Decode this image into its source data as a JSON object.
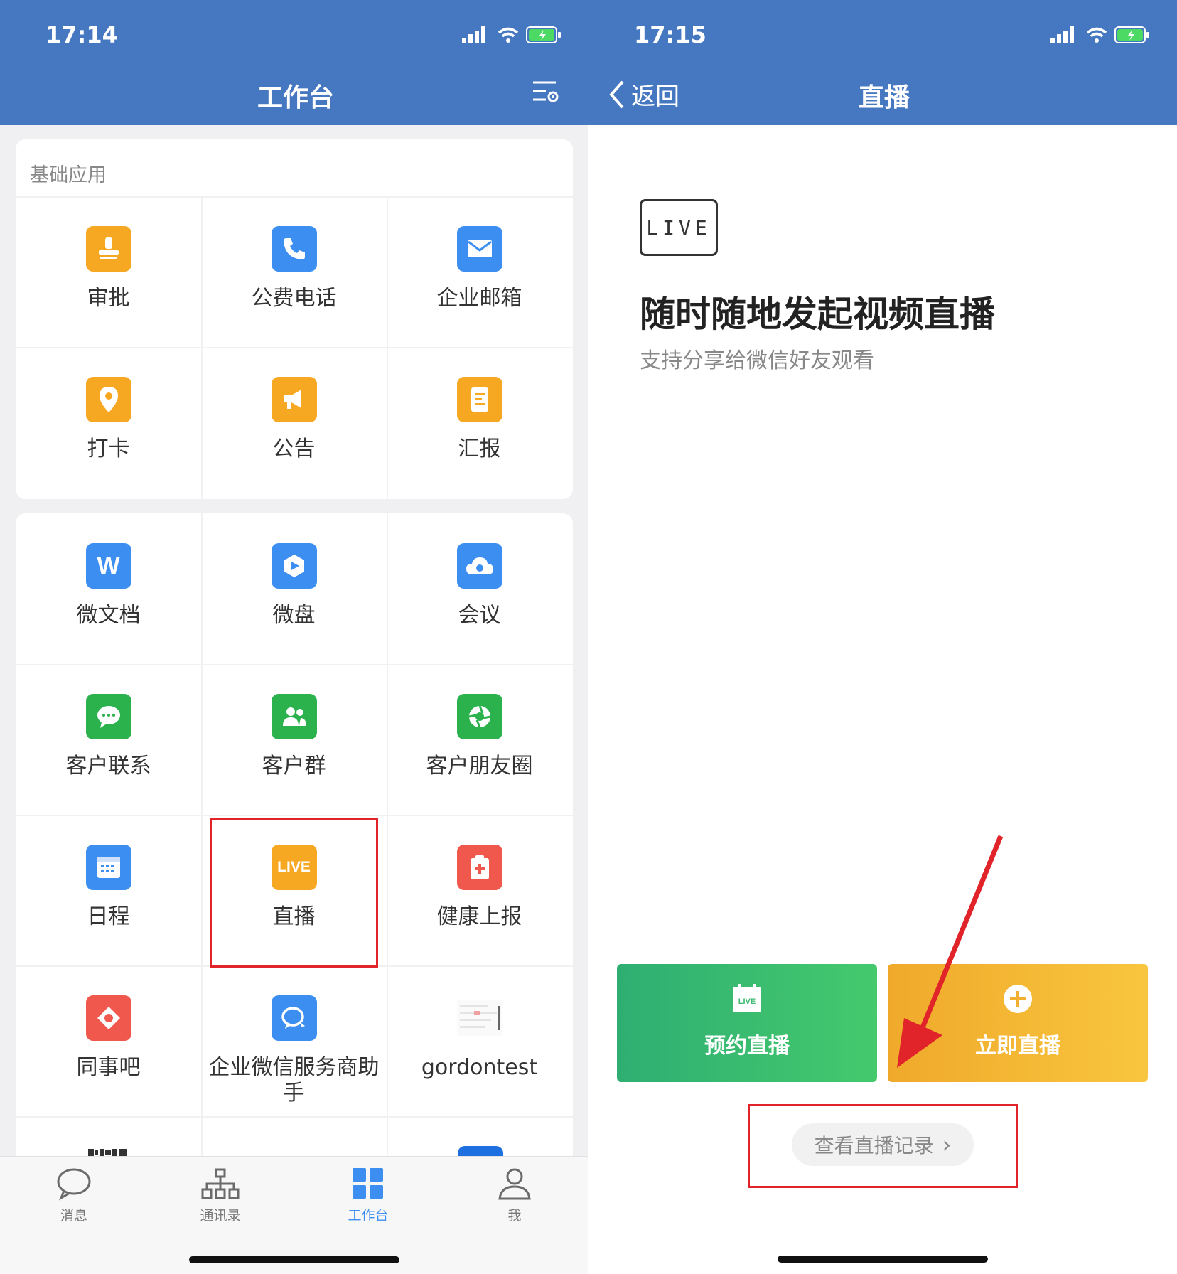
{
  "left_screen": {
    "status": {
      "time": "17:14"
    },
    "nav": {
      "title": "工作台"
    },
    "section_basic": {
      "title": "基础应用",
      "apps": [
        {
          "label": "审批",
          "icon": "stamp-icon",
          "color": "#f7a823"
        },
        {
          "label": "公费电话",
          "icon": "phone-icon",
          "color": "#3d8ef1"
        },
        {
          "label": "企业邮箱",
          "icon": "mail-icon",
          "color": "#3d8ef1"
        },
        {
          "label": "打卡",
          "icon": "location-pin-icon",
          "color": "#f7a823"
        },
        {
          "label": "公告",
          "icon": "megaphone-icon",
          "color": "#f7a823"
        },
        {
          "label": "汇报",
          "icon": "report-icon",
          "color": "#f7a823"
        }
      ]
    },
    "section_more": {
      "apps": [
        {
          "label": "微文档",
          "icon": "doc-w-icon",
          "color": "#3d8ef1"
        },
        {
          "label": "微盘",
          "icon": "drive-icon",
          "color": "#3d8ef1"
        },
        {
          "label": "会议",
          "icon": "cloud-meeting-icon",
          "color": "#3d8ef1"
        },
        {
          "label": "客户联系",
          "icon": "chat-bubble-icon",
          "color": "#2bb24c"
        },
        {
          "label": "客户群",
          "icon": "group-icon",
          "color": "#2bb24c"
        },
        {
          "label": "客户朋友圈",
          "icon": "aperture-icon",
          "color": "#2bb24c"
        },
        {
          "label": "日程",
          "icon": "calendar-icon",
          "color": "#3d8ef1"
        },
        {
          "label": "直播",
          "icon": "live-icon",
          "color": "#f7a823",
          "icon_text": "LIVE"
        },
        {
          "label": "健康上报",
          "icon": "medical-kit-icon",
          "color": "#f0574d"
        },
        {
          "label": "同事吧",
          "icon": "colleague-bar-icon",
          "color": "#f0574d"
        },
        {
          "label": "企业微信服务商助手",
          "icon": "service-chat-icon",
          "color": "#3d8ef1"
        },
        {
          "label": "gordontest",
          "icon": "thumbnail-icon",
          "color": "#dddddd"
        }
      ]
    },
    "tabbar": [
      {
        "label": "消息",
        "icon": "message-icon",
        "active": false
      },
      {
        "label": "通讯录",
        "icon": "contacts-icon",
        "active": false
      },
      {
        "label": "工作台",
        "icon": "workbench-icon",
        "active": true
      },
      {
        "label": "我",
        "icon": "profile-icon",
        "active": false
      }
    ]
  },
  "right_screen": {
    "status": {
      "time": "17:15"
    },
    "nav": {
      "back_label": "返回",
      "title": "直播"
    },
    "live_badge": "LIVE",
    "headline": "随时随地发起视频直播",
    "subline": "支持分享给微信好友观看",
    "buttons": {
      "schedule_label": "预约直播",
      "schedule_icon_text": "LIVE",
      "start_label": "立即直播"
    },
    "record_link": "查看直播记录",
    "record_chevron": "›"
  },
  "colors": {
    "header_blue": "#4677c1",
    "active_tab": "#3d8ef1",
    "highlight_red": "#e0242a",
    "green_button": "#3ec06a",
    "orange_button": "#f6b534"
  }
}
